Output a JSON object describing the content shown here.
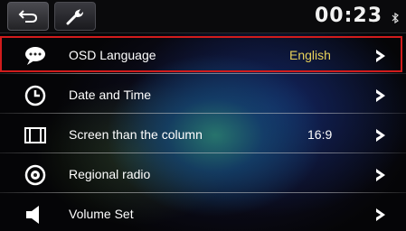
{
  "statusbar": {
    "time": "00:23"
  },
  "menu": {
    "items": [
      {
        "label": "OSD Language",
        "value": "English",
        "value_color": "#e8d25a",
        "icon": "speech-bubble-icon"
      },
      {
        "label": "Date and Time",
        "value": "",
        "icon": "clock-icon"
      },
      {
        "label": "Screen than the column",
        "value": "16:9",
        "value_color": "#ffffff",
        "icon": "screen-ratio-icon"
      },
      {
        "label": "Regional radio",
        "value": "",
        "icon": "radio-disc-icon"
      },
      {
        "label": "Volume Set",
        "value": "",
        "icon": "speaker-icon"
      }
    ],
    "selected_index": 0
  },
  "colors": {
    "selection_border": "#d11c1c",
    "value_highlight": "#e8d25a"
  }
}
